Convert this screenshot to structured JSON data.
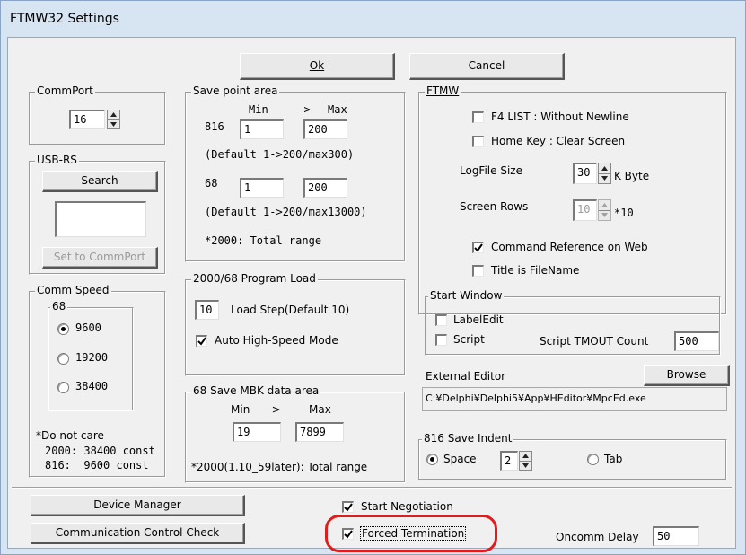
{
  "window": {
    "title": "FTMW32 Settings"
  },
  "buttons": {
    "ok": "Ok",
    "cancel": "Cancel",
    "search": "Search",
    "set_to_commport": "Set to CommPort",
    "browse": "Browse",
    "device_manager": "Device Manager",
    "communication_control_check": "Communication Control Check"
  },
  "commport": {
    "label": "CommPort",
    "value": "16"
  },
  "usb_rs": {
    "label": "USB-RS",
    "list_value": ""
  },
  "comm_speed": {
    "label": "Comm Speed",
    "sub_label": "68",
    "options": [
      "9600",
      "19200",
      "38400"
    ],
    "selected": "9600",
    "note_1": "*Do not care",
    "note_2": "2000: 38400 const",
    "note_3": "816:  9600 const"
  },
  "save_point_area": {
    "label": "Save point area",
    "header_min": "Min",
    "header_arrow": "-->",
    "header_max": "Max",
    "row_816_label": "816",
    "row_816_min": "1",
    "row_816_max": "200",
    "row_816_default": "(Default 1->200/max300)",
    "row_68_label": "68",
    "row_68_min": "1",
    "row_68_max": "200",
    "row_68_default": "(Default 1->200/max13000)",
    "note": "*2000: Total range"
  },
  "program_load": {
    "label": "2000/68 Program Load",
    "load_step_value": "10",
    "load_step_label": "Load Step(Default 10)",
    "auto_high_speed_label": "Auto High-Speed Mode",
    "auto_high_speed_checked": true
  },
  "mbk_area": {
    "label": "68 Save MBK data area",
    "header_min": "Min",
    "header_arrow": "-->",
    "header_max": "Max",
    "min_value": "19",
    "max_value": "7899",
    "note": "*2000(1.10_59later): Total range"
  },
  "ftmw": {
    "label": "FTMW",
    "f4_list_label": "F4 LIST : Without Newline",
    "f4_list_checked": false,
    "home_key_label": "Home Key : Clear Screen",
    "home_key_checked": false,
    "logfile_size_label": "LogFile Size",
    "logfile_size_value": "30",
    "logfile_size_unit": "K Byte",
    "screen_rows_label": "Screen Rows",
    "screen_rows_value": "10",
    "screen_rows_unit": "*10",
    "command_ref_label": "Command Reference on Web",
    "command_ref_checked": true,
    "title_filename_label": "Title is FileName",
    "title_filename_checked": false
  },
  "start_window": {
    "label": "Start Window",
    "label_edit_label": "LabelEdit",
    "label_edit_checked": false,
    "script_label": "Script",
    "script_checked": false,
    "tmout_label": "Script TMOUT Count",
    "tmout_value": "500"
  },
  "external_editor": {
    "label": "External Editor",
    "path": "C:¥Delphi¥Delphi5¥App¥HEditor¥MpcEd.exe"
  },
  "save_indent": {
    "label": "816 Save Indent",
    "space_label": "Space",
    "tab_label": "Tab",
    "selected": "Space",
    "indent_value": "2"
  },
  "bottom": {
    "start_negotiation_label": "Start Negotiation",
    "start_negotiation_checked": true,
    "forced_termination_label": "Forced Termination",
    "forced_termination_checked": true,
    "oncomm_delay_label": "Oncomm Delay",
    "oncomm_delay_value": "50"
  },
  "colors": {
    "highlight": "#e21b1b",
    "title_bar": "#d7e4f2",
    "client_bg": "#f0f0f0"
  }
}
